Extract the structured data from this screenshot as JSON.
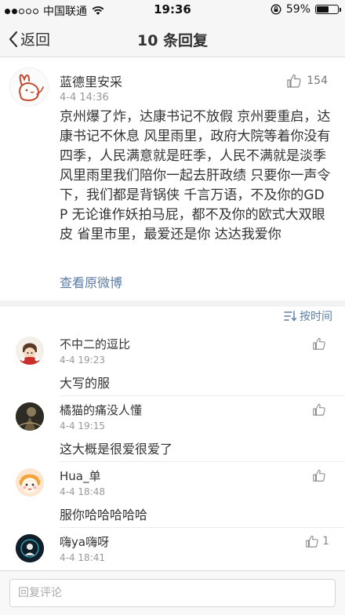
{
  "status_bar": {
    "carrier": "中国联通",
    "time": "19:36",
    "battery": "59%",
    "battery_level": 0.59
  },
  "nav": {
    "back_label": "返回",
    "title": "10 条回复"
  },
  "post": {
    "author": "蓝德里安采",
    "time": "4-4 14:36",
    "likes": "154",
    "body": "京州爆了炸，达康书记不放假 京州要重启，达康书记不休息 风里雨里，政府大院等着你没有四季，人民满意就是旺季，人民不满就是淡季 风里雨里我们陪你一起去肝政绩 只要你一声令下，我们都是背锅侠 千言万语，不及你的GDP 无论谁作妖拍马屁，都不及你的欧式大双眼皮 省里市里，最爱还是你 达达我爱你",
    "view_original": "查看原微博"
  },
  "sort_label": "按时间",
  "comments": [
    {
      "name": "不中二的逗比",
      "time": "4-4 19:23",
      "text": "大写的服",
      "likes": ""
    },
    {
      "name": "橘猫的痛没人懂",
      "time": "4-4 19:15",
      "text": "这大概是很爱很爱了",
      "likes": ""
    },
    {
      "name": "Hua_单",
      "time": "4-4 18:48",
      "text": "服你哈哈哈哈哈",
      "likes": ""
    },
    {
      "name": "嗨ya嗨呀",
      "time": "4-4 18:41",
      "text": "",
      "likes": "1"
    }
  ],
  "reply_placeholder": "回复评论",
  "colors": {
    "link": "#5b7da8",
    "text": "#333333",
    "meta": "#999999",
    "bar_bg": "#f6f6f6"
  }
}
